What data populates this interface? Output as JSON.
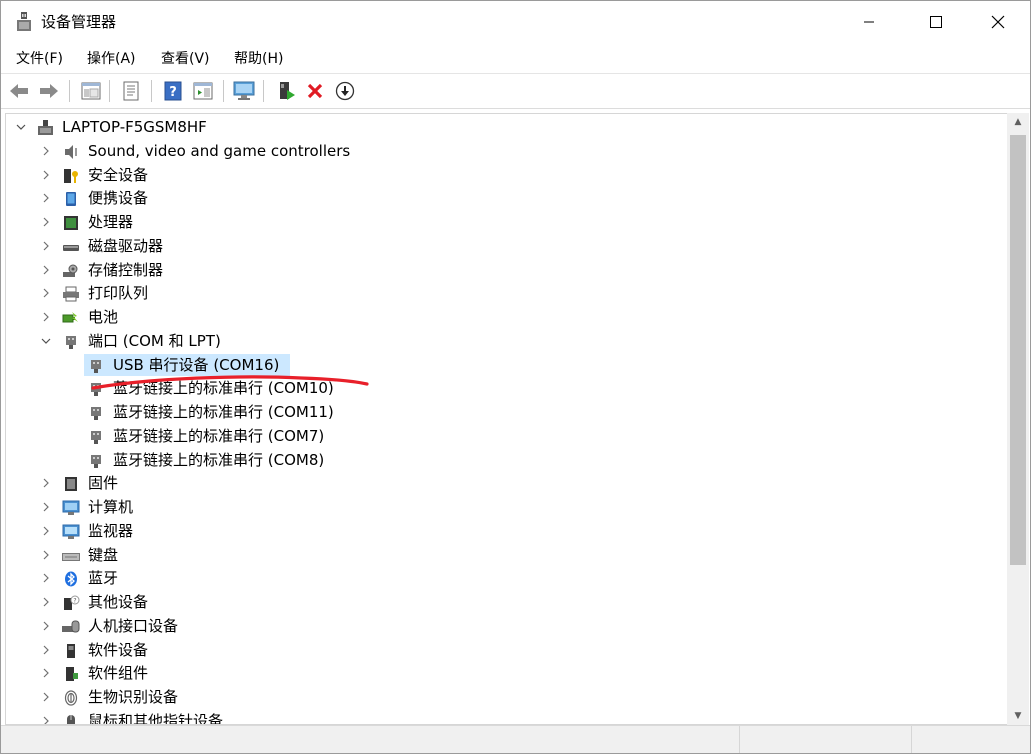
{
  "window": {
    "title": "设备管理器"
  },
  "menu": [
    {
      "label": "文件(F)"
    },
    {
      "label": "操作(A)"
    },
    {
      "label": "查看(V)"
    },
    {
      "label": "帮助(H)"
    }
  ],
  "tree": {
    "root": "LAPTOP-F5GSM8HF",
    "rows": [
      {
        "label": "Sound, video and game controllers",
        "icon": "speaker-icon"
      },
      {
        "label": "安全设备",
        "icon": "security-device-icon"
      },
      {
        "label": "便携设备",
        "icon": "portable-device-icon"
      },
      {
        "label": "处理器",
        "icon": "processor-icon"
      },
      {
        "label": "磁盘驱动器",
        "icon": "disk-drive-icon"
      },
      {
        "label": "存储控制器",
        "icon": "storage-controller-icon"
      },
      {
        "label": "打印队列",
        "icon": "printer-icon"
      },
      {
        "label": "电池",
        "icon": "battery-icon"
      },
      {
        "label": "端口 (COM 和 LPT)",
        "icon": "port-icon",
        "expanded": true,
        "children": [
          {
            "label": "USB 串行设备 (COM16)",
            "selected": true
          },
          {
            "label": "蓝牙链接上的标准串行 (COM10)"
          },
          {
            "label": "蓝牙链接上的标准串行 (COM11)"
          },
          {
            "label": "蓝牙链接上的标准串行 (COM7)"
          },
          {
            "label": "蓝牙链接上的标准串行 (COM8)"
          }
        ]
      },
      {
        "label": "固件",
        "icon": "firmware-icon"
      },
      {
        "label": "计算机",
        "icon": "computer-icon"
      },
      {
        "label": "监视器",
        "icon": "monitor-icon"
      },
      {
        "label": "键盘",
        "icon": "keyboard-icon"
      },
      {
        "label": "蓝牙",
        "icon": "bluetooth-icon"
      },
      {
        "label": "其他设备",
        "icon": "other-device-icon"
      },
      {
        "label": "人机接口设备",
        "icon": "hid-icon"
      },
      {
        "label": "软件设备",
        "icon": "software-device-icon"
      },
      {
        "label": "软件组件",
        "icon": "software-component-icon"
      },
      {
        "label": "生物识别设备",
        "icon": "biometric-icon"
      },
      {
        "label": "鼠标和其他指针设备",
        "icon": "mouse-icon"
      }
    ]
  },
  "colors": {
    "selection": "#cce8ff",
    "annotation": "#e8202a"
  }
}
